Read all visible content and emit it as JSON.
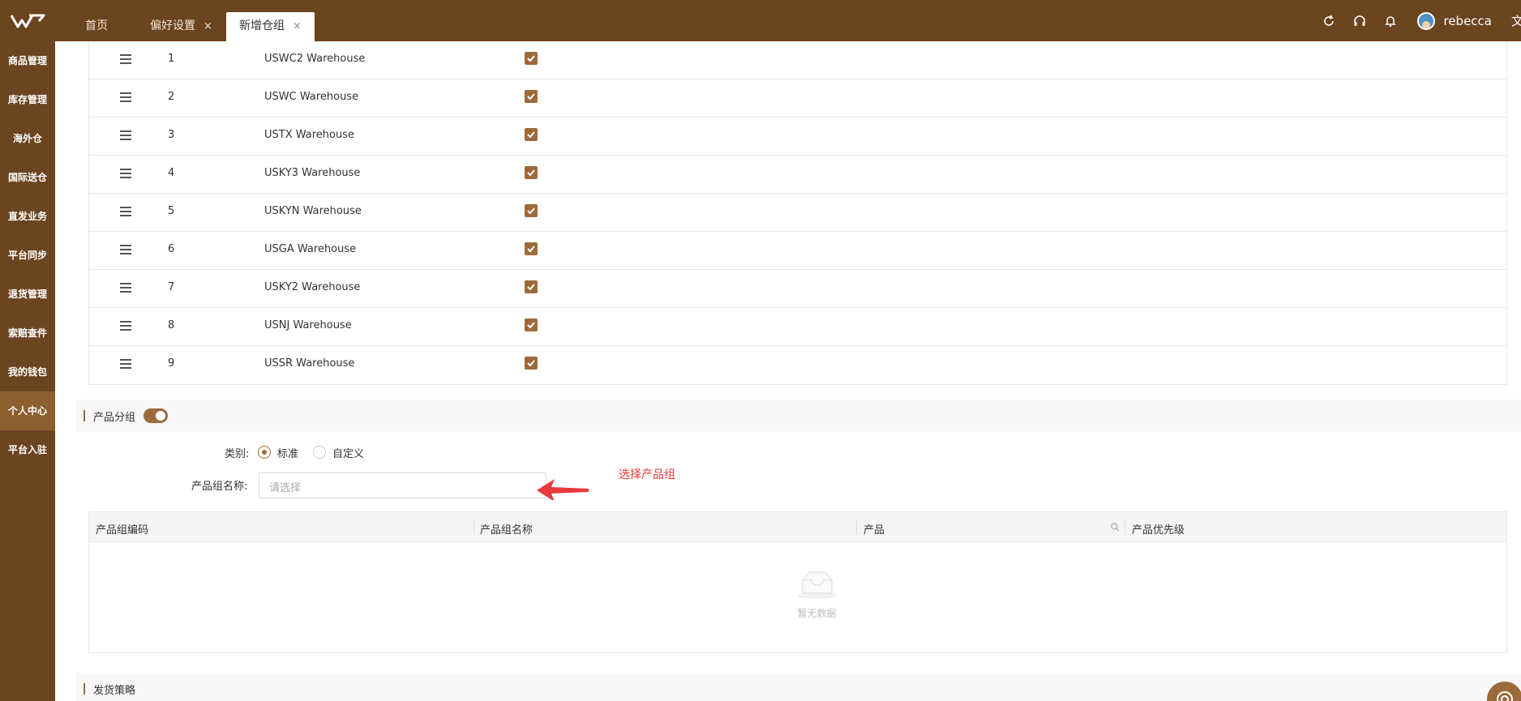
{
  "header": {
    "tabs": [
      {
        "label": "首页",
        "closable": false
      },
      {
        "label": "偏好设置",
        "closable": true
      },
      {
        "label": "新增仓组",
        "closable": true,
        "active": true
      }
    ],
    "close_glyph": "×",
    "icons": [
      "refresh-icon",
      "headset-icon",
      "bell-icon"
    ],
    "username": "rebecca",
    "lang_label": "文"
  },
  "sidebar": {
    "items": [
      {
        "label": "商品管理"
      },
      {
        "label": "库存管理"
      },
      {
        "label": "海外仓"
      },
      {
        "label": "国际送仓"
      },
      {
        "label": "直发业务"
      },
      {
        "label": "平台同步"
      },
      {
        "label": "退货管理"
      },
      {
        "label": "索赔查件"
      },
      {
        "label": "我的钱包"
      },
      {
        "label": "个人中心",
        "active": true
      },
      {
        "label": "平台入驻"
      }
    ]
  },
  "warehouses": [
    {
      "index": "1",
      "name": "USWC2 Warehouse",
      "checked": true
    },
    {
      "index": "2",
      "name": "USWC Warehouse",
      "checked": true
    },
    {
      "index": "3",
      "name": "USTX Warehouse",
      "checked": true
    },
    {
      "index": "4",
      "name": "USKY3 Warehouse",
      "checked": true
    },
    {
      "index": "5",
      "name": "USKYN Warehouse",
      "checked": true
    },
    {
      "index": "6",
      "name": "USGA Warehouse",
      "checked": true
    },
    {
      "index": "7",
      "name": "USKY2 Warehouse",
      "checked": true
    },
    {
      "index": "8",
      "name": "USNJ Warehouse",
      "checked": true
    },
    {
      "index": "9",
      "name": "USSR Warehouse",
      "checked": true
    }
  ],
  "product_group": {
    "title": "产品分组",
    "enabled": true,
    "category_label": "类别:",
    "options": [
      {
        "label": "标准",
        "selected": true
      },
      {
        "label": "自定义",
        "selected": false
      }
    ],
    "name_label": "产品组名称:",
    "name_placeholder": "请选择",
    "annotation": "选择产品组",
    "columns": [
      "产品组编码",
      "产品组名称",
      "产品",
      "产品优先级"
    ],
    "empty_text": "暂无数据"
  },
  "shipping": {
    "title": "发货策略"
  },
  "colors": {
    "brand": "#6b4420",
    "accent": "#9b6b3c",
    "annotation": "#e83a3a"
  }
}
